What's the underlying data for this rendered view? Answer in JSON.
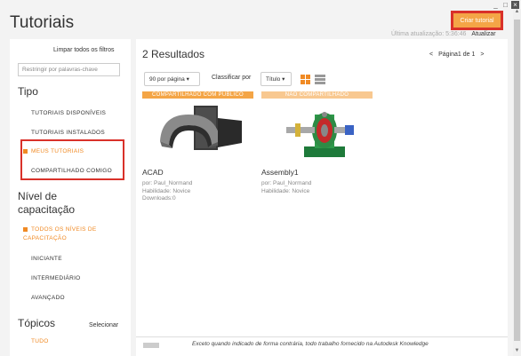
{
  "window": {
    "controls": [
      "_",
      "□",
      "×"
    ]
  },
  "header": {
    "title": "Tutoriais",
    "create_button": "Criar tutorial",
    "last_update_label": "Última atualização:",
    "last_update_time": "5:36:46",
    "update_link": "Atualizar"
  },
  "sidebar": {
    "clear_filters": "Limpar todos os filtros",
    "search_placeholder": "Restringir por palavras-chave",
    "tipo": {
      "title": "Tipo",
      "items": [
        "TUTORIAIS DISPONÍVEIS",
        "TUTORIAIS INSTALADOS",
        "MEUS TUTORIAIS",
        "COMPARTILHADO COMIGO"
      ]
    },
    "nivel": {
      "title_line1": "Nível de",
      "title_line2": "capacitação",
      "items": [
        "TODOS OS NÍVEIS DE",
        "CAPACITAÇÃO",
        "INICIANTE",
        "INTERMEDIÁRIO",
        "AVANÇADO"
      ]
    },
    "topicos": {
      "title": "Tópicos",
      "select_link": "Selecionar",
      "items": [
        "TUDO"
      ]
    }
  },
  "main": {
    "results": "2 Resultados",
    "pager": {
      "prev": "<",
      "label": "Página1 de 1",
      "next": ">"
    },
    "per_page": "90 por página",
    "sort_label": "Classificar por",
    "sort_value": "Título",
    "cards": [
      {
        "banner": "COMPARTILHADO COM PÚBLICO",
        "banner_color": "#f4a546",
        "title": "ACAD",
        "author": "por: Paul_Normand",
        "skill": "Habilidade: Novice",
        "downloads": "Downloads:0"
      },
      {
        "banner": "NÃO COMPARTILHADO",
        "banner_color": "#f8c890",
        "title": "Assembly1",
        "author": "por: Paul_Normand",
        "skill": "Habilidade: Novice",
        "downloads": ""
      }
    ],
    "footer": "Exceto quando indicado de forma contrária, todo trabalho fornecido na Autodesk Knowledge"
  },
  "colors": {
    "accent": "#f08a24",
    "highlight": "#d9312a"
  }
}
